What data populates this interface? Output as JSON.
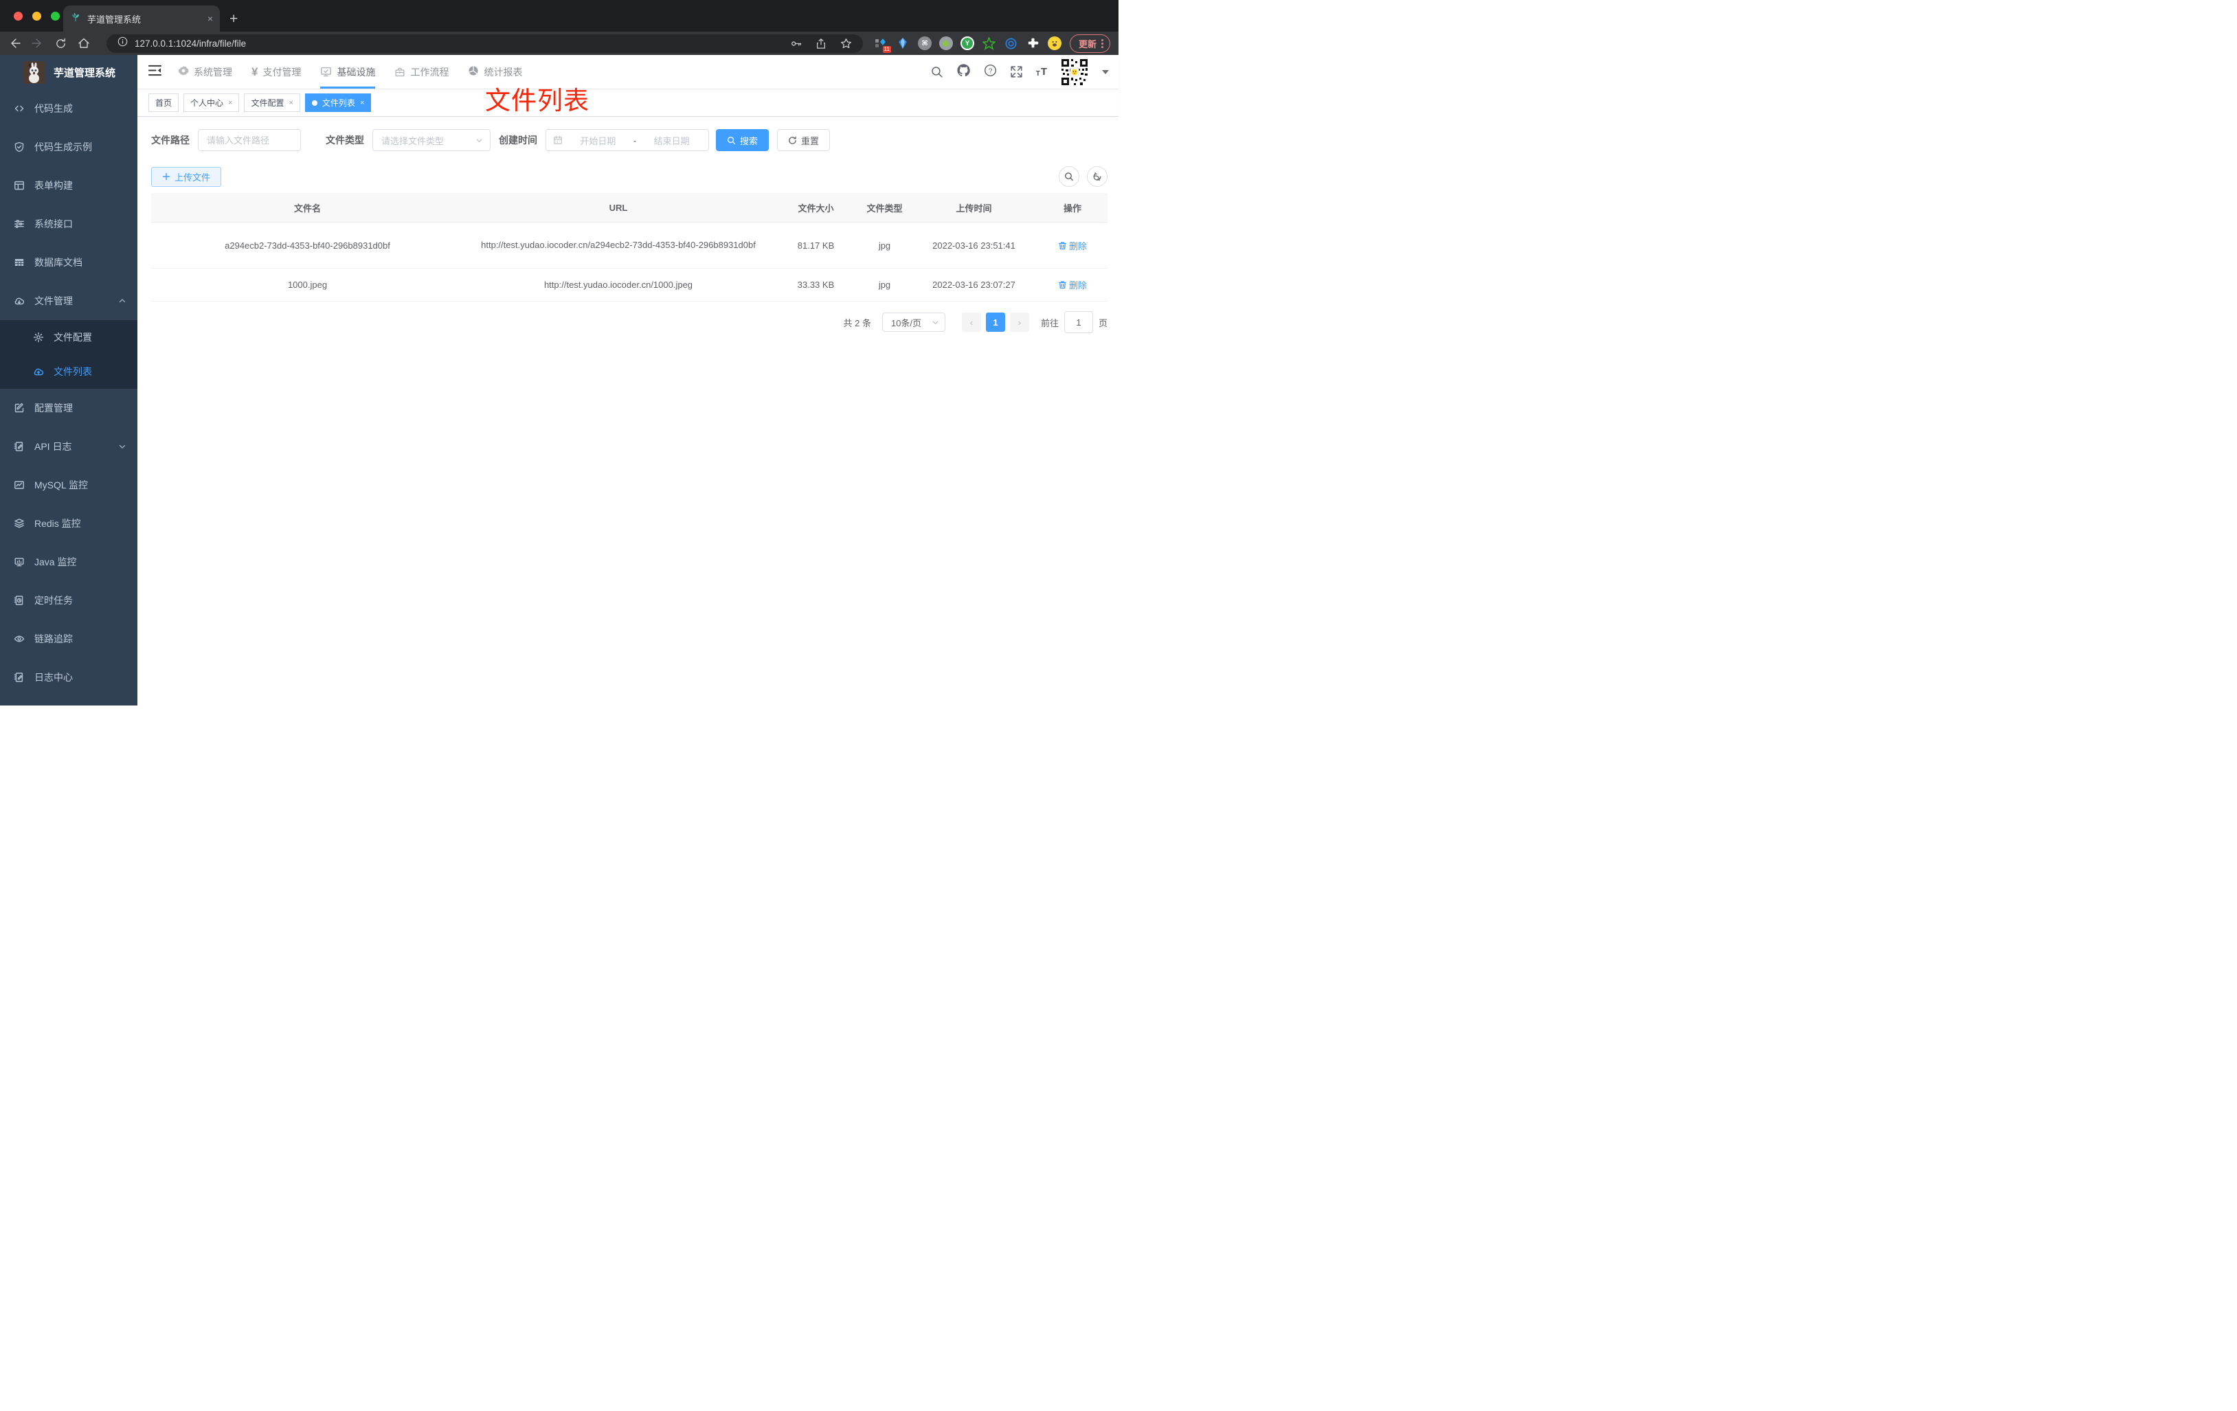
{
  "browser": {
    "tab_title": "芋道管理系统",
    "close_tab": "×",
    "new_tab": "+",
    "url": "127.0.0.1:1024/infra/file/file",
    "extension_badge": "11",
    "cmd_glyph": "⌘",
    "y_glyph": "Y",
    "update_label": "更新"
  },
  "sidebar": {
    "title": "芋道管理系统",
    "items": [
      {
        "label": "代码生成",
        "icon": "code-icon"
      },
      {
        "label": "代码生成示例",
        "icon": "shield-check-icon"
      },
      {
        "label": "表单构建",
        "icon": "form-grid-icon"
      },
      {
        "label": "系统接口",
        "icon": "sliders-icon"
      },
      {
        "label": "数据库文档",
        "icon": "database-table-icon"
      },
      {
        "label": "文件管理",
        "icon": "cloud-download-icon",
        "expanded": true
      },
      {
        "label": "文件配置",
        "icon": "gear-icon",
        "submenu": true
      },
      {
        "label": "文件列表",
        "icon": "cloud-upload-icon",
        "submenu": true,
        "active": true
      },
      {
        "label": "配置管理",
        "icon": "edit-square-icon"
      },
      {
        "label": "API 日志",
        "icon": "notebook-pen-icon",
        "collapsed": true
      },
      {
        "label": "MySQL 监控",
        "icon": "chart-monitor-icon"
      },
      {
        "label": "Redis 监控",
        "icon": "layers-icon"
      },
      {
        "label": "Java 监控",
        "icon": "java-monitor-icon"
      },
      {
        "label": "定时任务",
        "icon": "schedule-icon"
      },
      {
        "label": "链路追踪",
        "icon": "eye-icon"
      },
      {
        "label": "日志中心",
        "icon": "log-center-icon"
      }
    ]
  },
  "topnav": {
    "items": [
      {
        "label": "系统管理",
        "icon": "gear-icon"
      },
      {
        "label": "支付管理",
        "icon": "yen-icon",
        "glyph": "¥"
      },
      {
        "label": "基础设施",
        "icon": "monitor-check-icon",
        "active": true
      },
      {
        "label": "工作流程",
        "icon": "briefcase-icon"
      },
      {
        "label": "统计报表",
        "icon": "pie-chart-icon"
      }
    ]
  },
  "tags": [
    {
      "label": "首页",
      "closable": false
    },
    {
      "label": "个人中心",
      "closable": true
    },
    {
      "label": "文件配置",
      "closable": true
    },
    {
      "label": "文件列表",
      "closable": true,
      "active": true
    }
  ],
  "tag_close_glyph": "×",
  "annotation": {
    "text": "文件列表",
    "color": "#f5270b"
  },
  "filters": {
    "path_label": "文件路径",
    "path_placeholder": "请输入文件路径",
    "type_label": "文件类型",
    "type_placeholder": "请选择文件类型",
    "date_label": "创建时间",
    "date_start_placeholder": "开始日期",
    "date_separator": "-",
    "date_end_placeholder": "结束日期",
    "search_label": "搜索",
    "reset_label": "重置"
  },
  "actions": {
    "upload_label": "上传文件"
  },
  "table": {
    "headers": [
      "文件名",
      "URL",
      "文件大小",
      "文件类型",
      "上传时间",
      "操作"
    ],
    "rows": [
      {
        "name": "a294ecb2-73dd-4353-bf40-296b8931d0bf",
        "url": "http://test.yudao.iocoder.cn/a294ecb2-73dd-4353-bf40-296b8931d0bf",
        "size": "81.17 KB",
        "type": "jpg",
        "time": "2022-03-16 23:51:41",
        "action": "删除"
      },
      {
        "name": "1000.jpeg",
        "url": "http://test.yudao.iocoder.cn/1000.jpeg",
        "size": "33.33 KB",
        "type": "jpg",
        "time": "2022-03-16 23:07:27",
        "action": "删除"
      }
    ]
  },
  "pagination": {
    "total": "共 2 条",
    "page_size": "10条/页",
    "prev_glyph": "‹",
    "current_page": "1",
    "next_glyph": "›",
    "goto_label": "前往",
    "goto_value": "1",
    "goto_unit": "页"
  },
  "colors": {
    "accent": "#409eff",
    "sidebar_bg": "#304156",
    "submenu_bg": "#1f2d3d",
    "annotation_red": "#f5270b",
    "tag_active": "#409eff"
  }
}
